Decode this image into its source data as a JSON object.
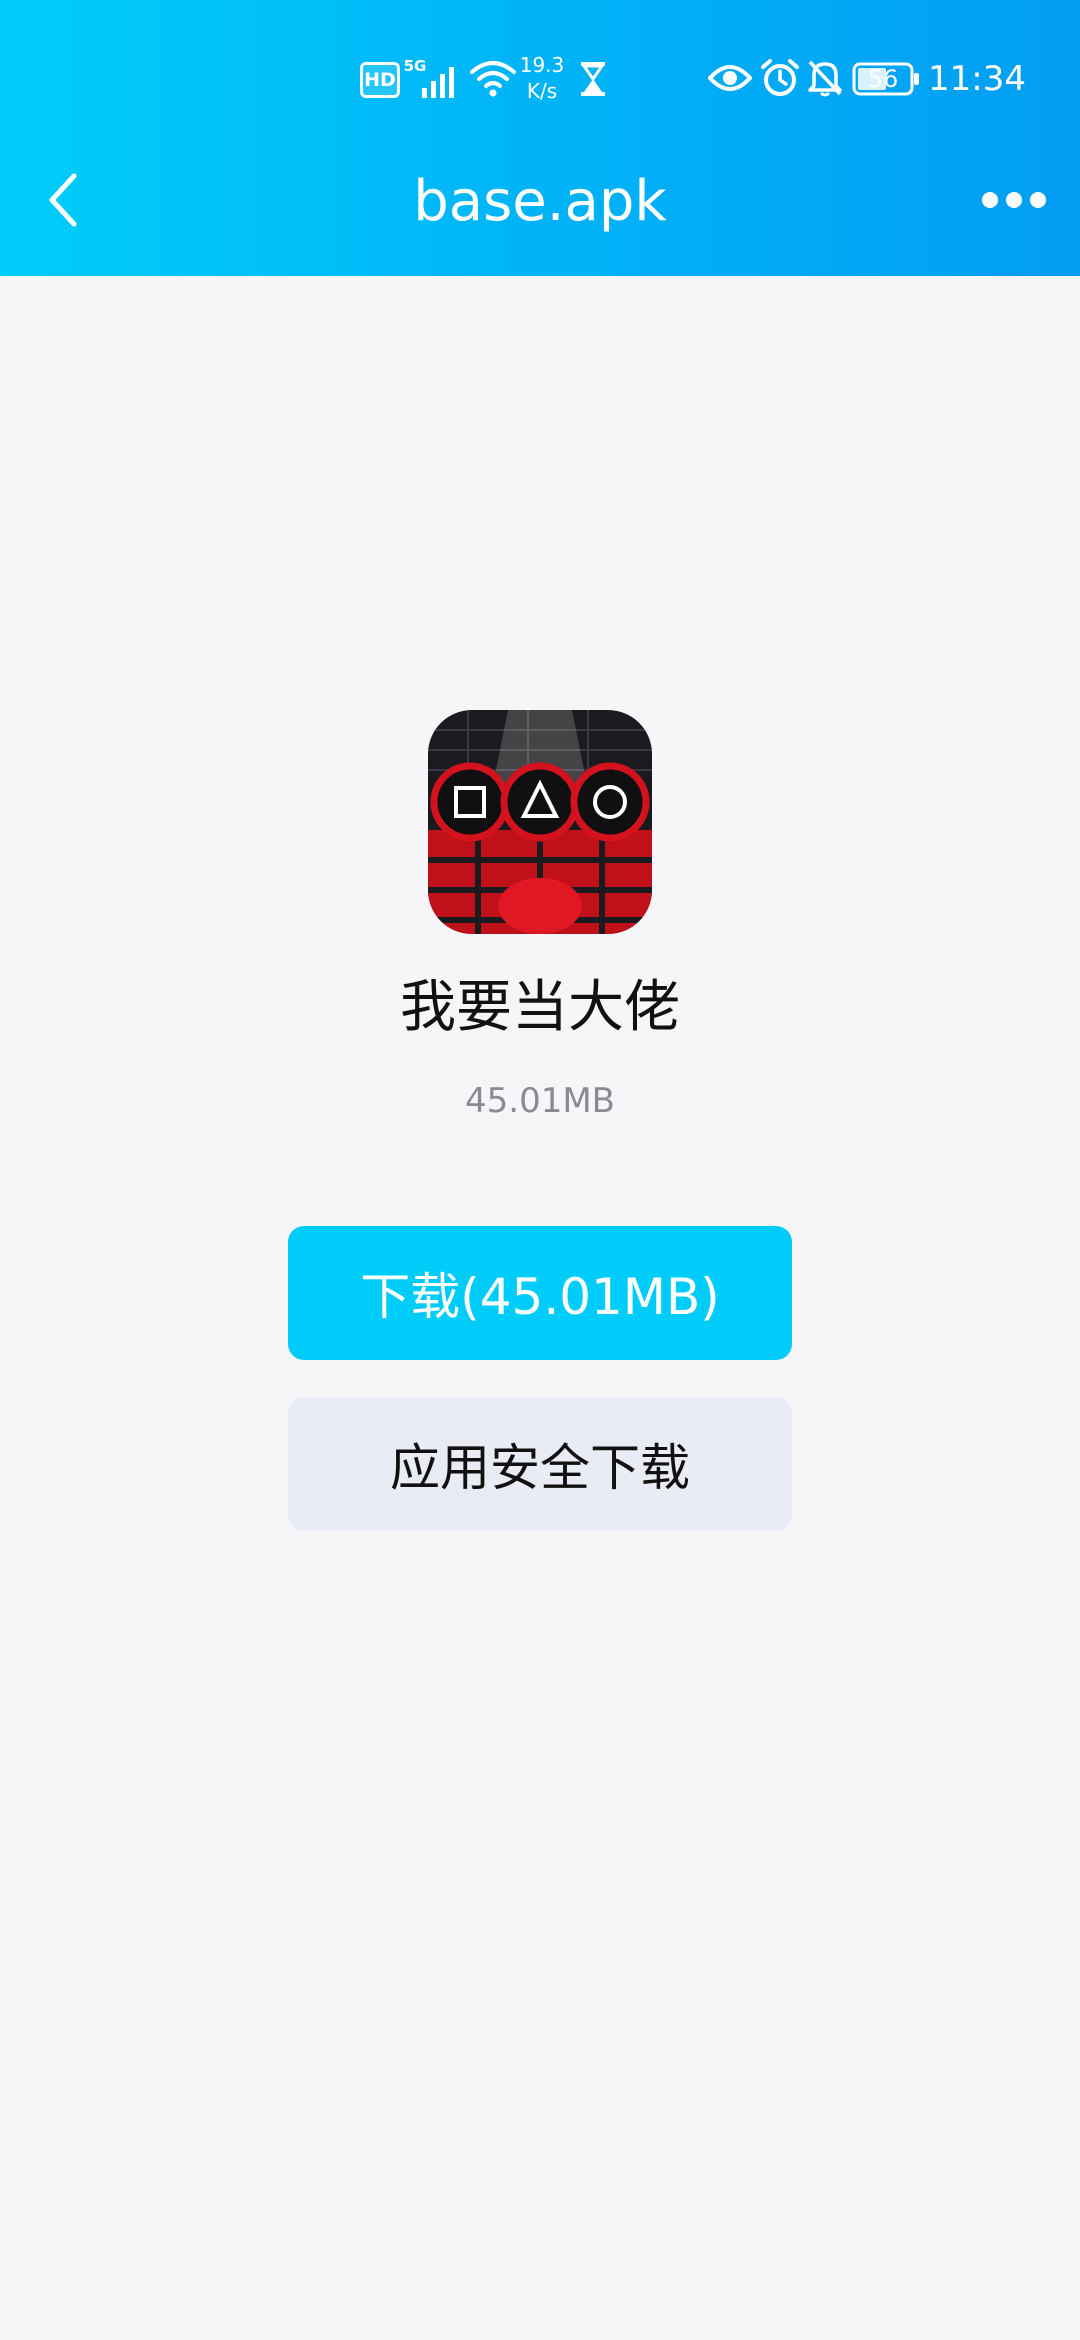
{
  "status_bar": {
    "hd": "HD",
    "network": "5G",
    "speed_value": "19.3",
    "speed_unit": "K/s",
    "battery": "56",
    "time": "11:34"
  },
  "header": {
    "title": "base.apk"
  },
  "app": {
    "name": "我要当大佬",
    "size": "45.01MB"
  },
  "actions": {
    "download_label": "下载(45.01MB)",
    "safe_download_label": "应用安全下载"
  },
  "colors": {
    "header_gradient_start": "#00cdfb",
    "header_gradient_end": "#039df2",
    "primary_button": "#00ccfa",
    "secondary_button": "#e9ebf5",
    "background": "#f6f6f8"
  },
  "icons": [
    "hd-icon",
    "5g-icon",
    "signal-icon",
    "wifi-icon",
    "hourglass-icon",
    "eye-icon",
    "alarm-icon",
    "mute-icon",
    "battery-icon",
    "back-icon",
    "more-icon",
    "app-icon"
  ]
}
